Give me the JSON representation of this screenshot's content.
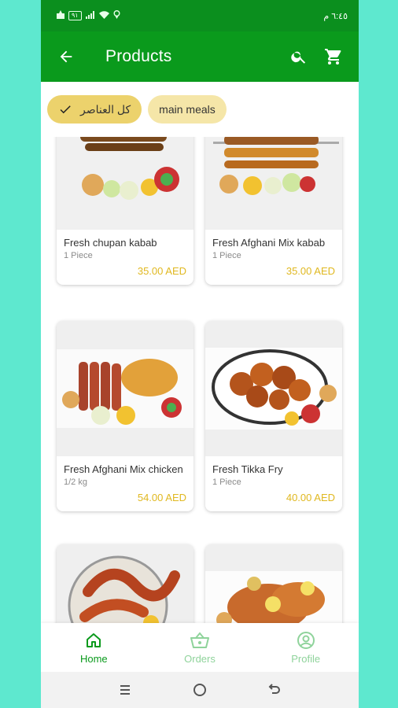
{
  "status_bar": {
    "time": "٦:٤٥ م",
    "battery": "٩١"
  },
  "app_bar": {
    "title": "Products"
  },
  "chips": [
    {
      "label": "كل العناصر",
      "selected": true
    },
    {
      "label": "main meals",
      "selected": false
    }
  ],
  "products": [
    {
      "name": "Fresh chupan kabab",
      "unit": "1 Piece",
      "price": "35.00 AED"
    },
    {
      "name": "Fresh Afghani  Mix kabab",
      "unit": "1 Piece",
      "price": "35.00 AED"
    },
    {
      "name": "Fresh Afghani  Mix chicken",
      "unit": "1/2 kg",
      "price": "54.00 AED"
    },
    {
      "name": "Fresh Tikka Fry",
      "unit": "1 Piece",
      "price": "40.00 AED"
    },
    {
      "name": "",
      "unit": "",
      "price": ""
    },
    {
      "name": "",
      "unit": "",
      "price": ""
    }
  ],
  "bottom_nav": [
    {
      "label": "Home",
      "icon": "home-icon",
      "active": true
    },
    {
      "label": "Orders",
      "icon": "basket-icon",
      "active": false
    },
    {
      "label": "Profile",
      "icon": "profile-icon",
      "active": false
    }
  ],
  "colors": {
    "primary": "#0a9a1c",
    "chip": "#f5e6a8",
    "price": "#e0b820",
    "background": "#5ee8cf"
  }
}
